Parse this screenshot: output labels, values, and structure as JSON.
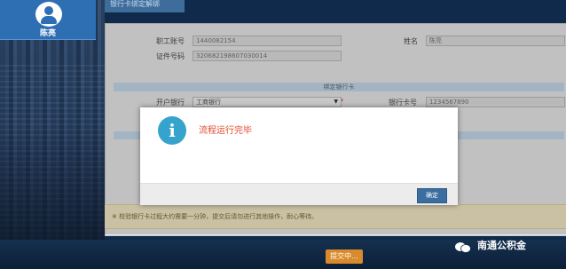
{
  "user": {
    "name": "陈亮"
  },
  "header": {
    "tab_title": "银行卡绑定解绑"
  },
  "form": {
    "employee_no_label": "职工账号",
    "employee_no_value": "1440082154",
    "id_no_label": "证件号码",
    "id_no_value": "320682198607030014",
    "name_label": "姓名",
    "name_value": "陈亮",
    "bank_section_title": "绑定银行卡",
    "bank_label": "开户银行",
    "bank_value": "工商银行",
    "card_no_label": "银行卡号",
    "card_no_value": "1234567890",
    "required_mark": "*"
  },
  "notice": {
    "text": "※ 校验银行卡过程大约需要一分钟，提交后请勿进行其他操作，耐心等待。"
  },
  "buttons": {
    "submit_label": "提交中...",
    "ok_label": "确定"
  },
  "dialog": {
    "message": "流程运行完毕",
    "icon": "info-icon"
  },
  "watermark": {
    "text": "南通公积金"
  },
  "colors": {
    "dialog_message": "#e04a2c",
    "info_icon": "#35a3cb",
    "ok_button": "#3a6da0",
    "submit_button": "#d98a2c"
  }
}
